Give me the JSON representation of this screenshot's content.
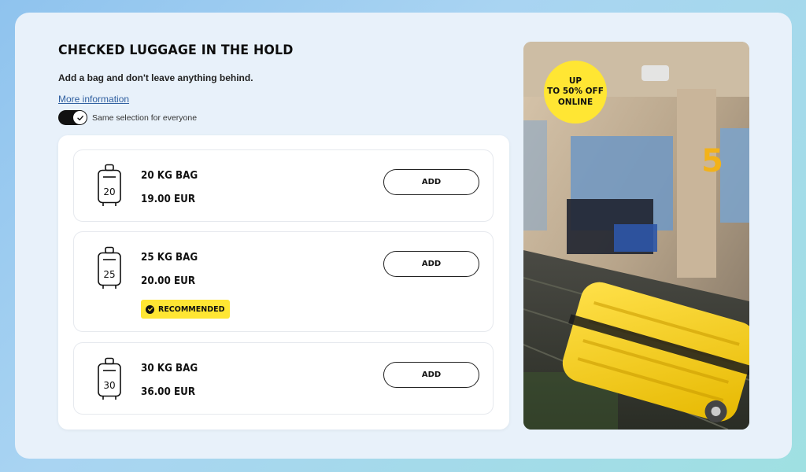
{
  "header": {
    "title": "CHECKED LUGGAGE IN THE HOLD",
    "subtitle": "Add a bag and don't leave anything behind.",
    "more_link": "More information"
  },
  "toggle": {
    "label": "Same selection for everyone",
    "checked": true
  },
  "options": [
    {
      "name": "20 KG BAG",
      "price": "19.00 EUR",
      "icon_number": "20",
      "button": "ADD"
    },
    {
      "name": "25 KG BAG",
      "price": "20.00 EUR",
      "icon_number": "25",
      "button": "ADD",
      "badge": "RECOMMENDED"
    },
    {
      "name": "30 KG BAG",
      "price": "36.00 EUR",
      "icon_number": "30",
      "button": "ADD"
    }
  ],
  "promo": {
    "line1": "UP",
    "line2": "TO 50% OFF",
    "line3": "ONLINE"
  },
  "photo": {
    "gate_number": "5"
  },
  "colors": {
    "accent_yellow": "#ffe633",
    "link_blue": "#2f5fa0",
    "card_bg": "#e8f1fa"
  }
}
